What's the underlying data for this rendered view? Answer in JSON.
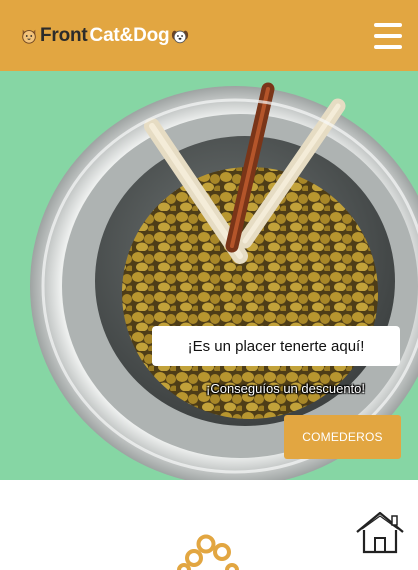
{
  "navbar": {
    "brand_front": "Front",
    "brand_catdog": "Cat&Dog",
    "cat_icon": "cat-face-icon",
    "dog_icon": "dog-face-icon",
    "menu_icon": "hamburger-menu-icon"
  },
  "hero": {
    "image": "dog-food-bowl-with-treats",
    "title": "¡Es un placer tenerte aquí!",
    "subtitle": "¡Conseguíos un descuento!",
    "button_label": "COMEDEROS"
  },
  "footer_section": {
    "paw_icon": "paw-icon",
    "home_icon": "home-icon"
  },
  "colors": {
    "brand": "#e2a641",
    "hero_bg": "#86d6a4",
    "white": "#ffffff"
  }
}
